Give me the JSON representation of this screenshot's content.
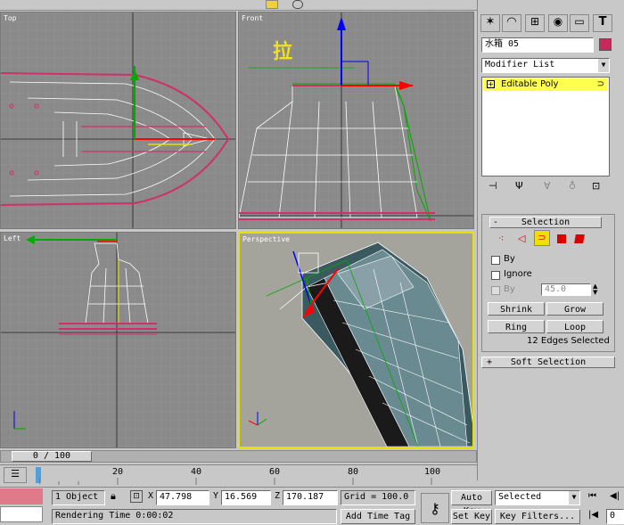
{
  "viewports": {
    "top_label": "Top",
    "front_label": "Front",
    "left_label": "Left",
    "perspective_label": "Perspective",
    "annotation": "拉"
  },
  "command_panel": {
    "object_name": "水箱  05",
    "object_color": "#c8285a",
    "modifier_list": "Modifier List",
    "stack_item": "Editable Poly",
    "selection": {
      "title": "Selection",
      "by_label": "By",
      "ignore_label": "Ignore",
      "by_angle_label": "By",
      "angle_value": "45.0",
      "shrink": "Shrink",
      "grow": "Grow",
      "ring": "Ring",
      "loop": "Loop",
      "status": "12 Edges Selected"
    },
    "soft_selection": "Soft Selection"
  },
  "timeline": {
    "slider": "0 / 100",
    "ticks": [
      "20",
      "40",
      "60",
      "80",
      "100"
    ]
  },
  "status": {
    "objects": "1 Object",
    "x_label": "X",
    "x": "47.798",
    "y_label": "Y",
    "y": "16.569",
    "z_label": "Z",
    "z": "170.187",
    "grid": "Grid = 100.0",
    "rendering_time": "Rendering Time  0:00:02",
    "add_time_tag": "Add Time Tag",
    "auto_key": "Auto Key",
    "set_key": "Set Key",
    "selected": "Selected",
    "key_filters": "Key Filters...",
    "frame": "0"
  },
  "colors": {
    "accent_yellow": "#ffff00",
    "selection_pink": "#c8285a",
    "mesh_white": "#ffffff",
    "x_axis": "#ff0000",
    "y_axis": "#00aa00",
    "z_axis": "#0000ff"
  }
}
